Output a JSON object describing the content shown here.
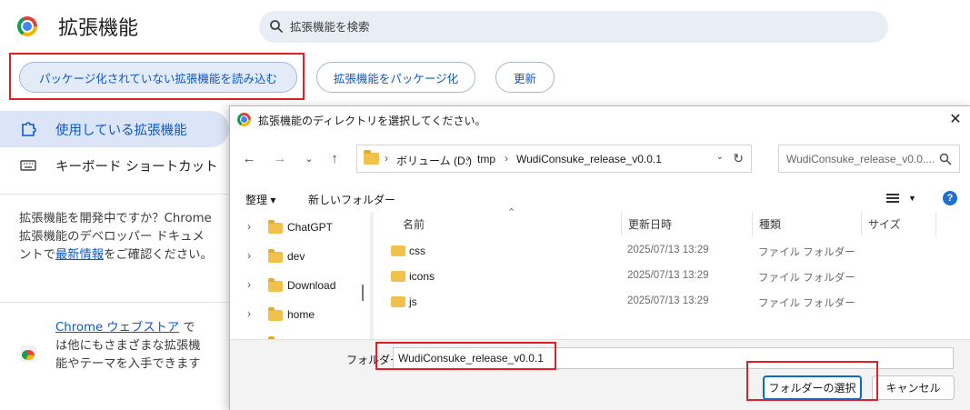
{
  "header": {
    "title": "拡張機能",
    "search_placeholder": "拡張機能を検索"
  },
  "toolbar": {
    "load_unpacked": "パッケージ化されていない拡張機能を読み込む",
    "pack": "拡張機能をパッケージ化",
    "update": "更新"
  },
  "sidebar": {
    "items": [
      {
        "label": "使用している拡張機能",
        "icon": "puzzle-icon",
        "active": true
      },
      {
        "label": "キーボード ショートカット",
        "icon": "keyboard-icon",
        "active": false
      }
    ],
    "dev_text_before": "拡張機能を開発中ですか？Chrome 拡張機能のデベロッパー ドキュメントで",
    "dev_link": "最新情報",
    "dev_text_after": "をご確認ください。",
    "store_link": "Chrome ウェブストア",
    "store_text": " では他にもさまざまな拡張機能やテーマを入手できます"
  },
  "dialog": {
    "title": "拡張機能のディレクトリを選択してください。",
    "breadcrumb": [
      "ボリューム (D:)",
      "tmp",
      "WudiConsuke_release_v0.0.1"
    ],
    "search_placeholder": "WudiConsuke_release_v0.0....",
    "organize": "整理 ▾",
    "new_folder": "新しいフォルダー",
    "tree": [
      "ChatGPT",
      "dev",
      "Download",
      "home"
    ],
    "columns": [
      "名前",
      "更新日時",
      "種類",
      "サイズ"
    ],
    "files": [
      {
        "name": "css",
        "date": "2025/07/13 13:29",
        "type": "ファイル フォルダー"
      },
      {
        "name": "icons",
        "date": "2025/07/13 13:29",
        "type": "ファイル フォルダー"
      },
      {
        "name": "js",
        "date": "2025/07/13 13:29",
        "type": "ファイル フォルダー"
      }
    ],
    "folder_label": "フォルダー:",
    "folder_value": "WudiConsuke_release_v0.0.1",
    "select_button": "フォルダーの選択",
    "cancel_button": "キャンセル"
  }
}
